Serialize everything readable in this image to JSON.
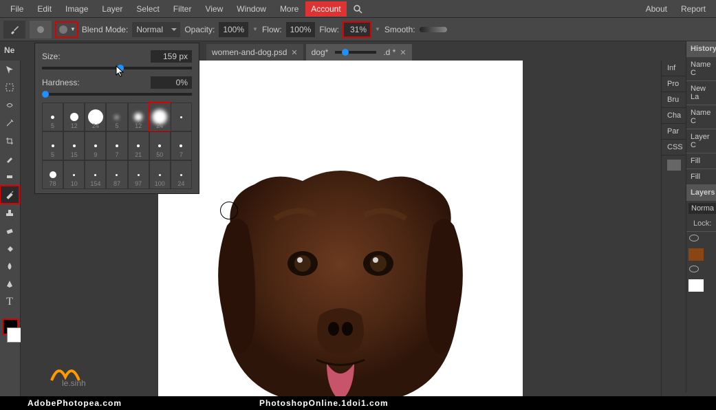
{
  "menu": {
    "items": [
      "File",
      "Edit",
      "Image",
      "Layer",
      "Select",
      "Filter",
      "View",
      "Window",
      "More"
    ],
    "account": "Account",
    "right": [
      "About",
      "Report"
    ]
  },
  "options": {
    "blend_label": "Blend Mode:",
    "blend_value": "Normal",
    "opacity_label": "Opacity:",
    "opacity_value": "100%",
    "flow_label": "Flow:",
    "flow_value": "100%",
    "flow2_label": "Flow:",
    "flow2_value": "31%",
    "smooth_label": "Smooth:"
  },
  "tabs": {
    "prefix": "Ne",
    "items": [
      {
        "label": "women-and-dog.psd"
      },
      {
        "label": "dog*"
      }
    ]
  },
  "brushpanel": {
    "size_label": "Size:",
    "size_value": "159 px",
    "hardness_label": "Hardness:",
    "hardness_value": "0%",
    "presets": [
      {
        "d": 5,
        "s": "5"
      },
      {
        "d": 12,
        "s": "12"
      },
      {
        "d": 24,
        "s": "24"
      },
      {
        "d": 5,
        "s": "5",
        "soft": true
      },
      {
        "d": 12,
        "s": "12",
        "soft": true
      },
      {
        "d": 24,
        "s": "24",
        "soft": true,
        "hl": true
      },
      {
        "d": 0,
        "s": ""
      },
      {
        "d": 4,
        "s": "5"
      },
      {
        "d": 4,
        "s": "15"
      },
      {
        "d": 4,
        "s": "9"
      },
      {
        "d": 4,
        "s": "7"
      },
      {
        "d": 4,
        "s": "21"
      },
      {
        "d": 4,
        "s": "50"
      },
      {
        "d": 4,
        "s": "7"
      },
      {
        "d": 10,
        "s": "78"
      },
      {
        "d": 3,
        "s": "10"
      },
      {
        "d": 3,
        "s": "154"
      },
      {
        "d": 3,
        "s": "87"
      },
      {
        "d": 3,
        "s": "97"
      },
      {
        "d": 3,
        "s": "100"
      },
      {
        "d": 3,
        "s": "24"
      }
    ]
  },
  "right_tabs": [
    "Inf",
    "Pro",
    "Bru",
    "Cha",
    "Par",
    "CSS"
  ],
  "history": {
    "title": "History",
    "items": [
      "Name C",
      "New La",
      "Name C",
      "Layer C",
      "Fill",
      "Fill"
    ]
  },
  "layers": {
    "title": "Layers",
    "blend": "Norma",
    "lock": "Lock:"
  },
  "footer": {
    "left": "AdobePhotopea.com",
    "right": "PhotoshopOnline.1doi1.com"
  }
}
